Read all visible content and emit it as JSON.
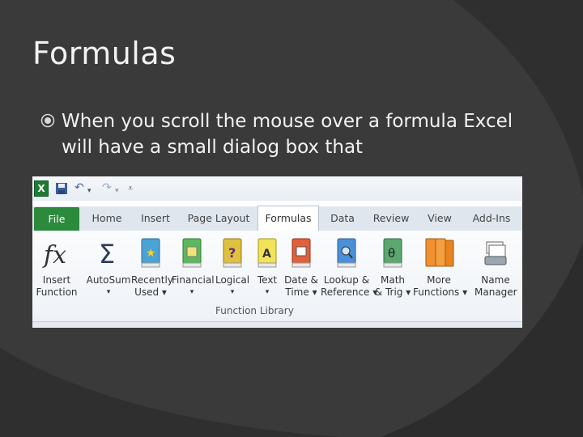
{
  "slide": {
    "title": "Formulas",
    "bullet": "When you scroll the mouse over a formula Excel will have a small dialog box that"
  },
  "ribbon": {
    "tabs": [
      "File",
      "Home",
      "Insert",
      "Page Layout",
      "Formulas",
      "Data",
      "Review",
      "View",
      "Add-Ins"
    ],
    "active_tab": "Formulas",
    "buttons": [
      {
        "line1": "Insert",
        "line2": "Function",
        "icon": "fx-icon"
      },
      {
        "line1": "AutoSum",
        "line2": "▾",
        "icon": "sigma-icon"
      },
      {
        "line1": "Recently",
        "line2": "Used ▾",
        "icon": "book-star-icon"
      },
      {
        "line1": "Financial",
        "line2": "▾",
        "icon": "book-financial-icon"
      },
      {
        "line1": "Logical",
        "line2": "▾",
        "icon": "book-question-icon"
      },
      {
        "line1": "Text",
        "line2": "▾",
        "icon": "book-text-icon"
      },
      {
        "line1": "Date &",
        "line2": "Time ▾",
        "icon": "book-calendar-icon"
      },
      {
        "line1": "Lookup &",
        "line2": "Reference ▾",
        "icon": "book-search-icon"
      },
      {
        "line1": "Math",
        "line2": "& Trig ▾",
        "icon": "book-theta-icon"
      },
      {
        "line1": "More",
        "line2": "Functions ▾",
        "icon": "books-icon"
      },
      {
        "line1": "Name",
        "line2": "Manager",
        "icon": "name-manager-icon"
      }
    ],
    "group_label": "Function Library"
  },
  "colors": {
    "background": "#3a3a3a",
    "file_tab": "#2c8a3c"
  }
}
